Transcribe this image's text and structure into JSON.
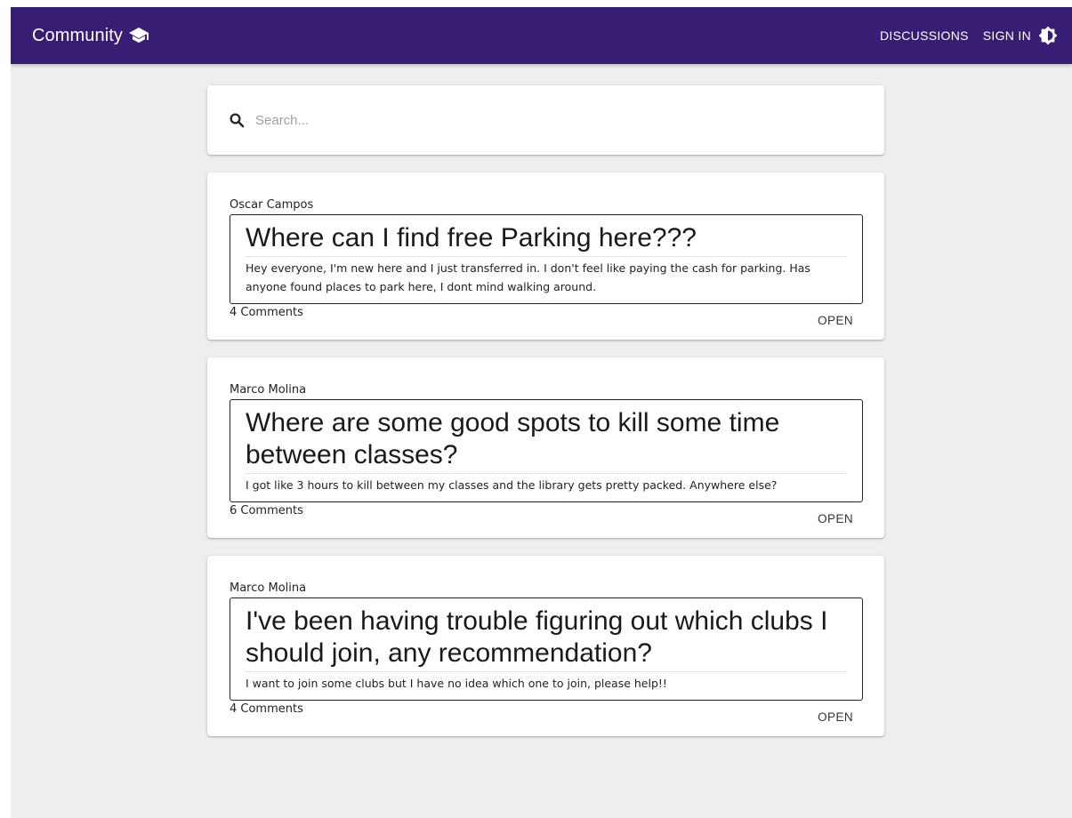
{
  "appbar": {
    "brand": "Community",
    "brand_icon": "graduation-cap-icon",
    "nav": [
      "DISCUSSIONS",
      "SIGN IN"
    ],
    "theme_icon": "brightness-icon",
    "color": "#381d75"
  },
  "search": {
    "placeholder": "Search...",
    "icon": "search-icon"
  },
  "posts": [
    {
      "author": "Oscar Campos",
      "title": "Where can I find free Parking here???",
      "body": "Hey everyone, I'm new here and I just transferred in. I don't feel like paying the cash for parking. Has anyone found places to park here, I dont mind walking around.",
      "comments": "4 Comments",
      "action": "OPEN"
    },
    {
      "author": "Marco Molina",
      "title": "Where are some good spots to kill some time between classes?",
      "body": "I got like 3 hours to kill between my classes and the library gets pretty packed. Anywhere else?",
      "comments": "6 Comments",
      "action": "OPEN"
    },
    {
      "author": "Marco Molina",
      "title": "I've been having trouble figuring out which clubs I should join, any recommendation?",
      "body": "I want to join some clubs but I have no idea which one to join, please help!!",
      "comments": "4 Comments",
      "action": "OPEN"
    }
  ]
}
